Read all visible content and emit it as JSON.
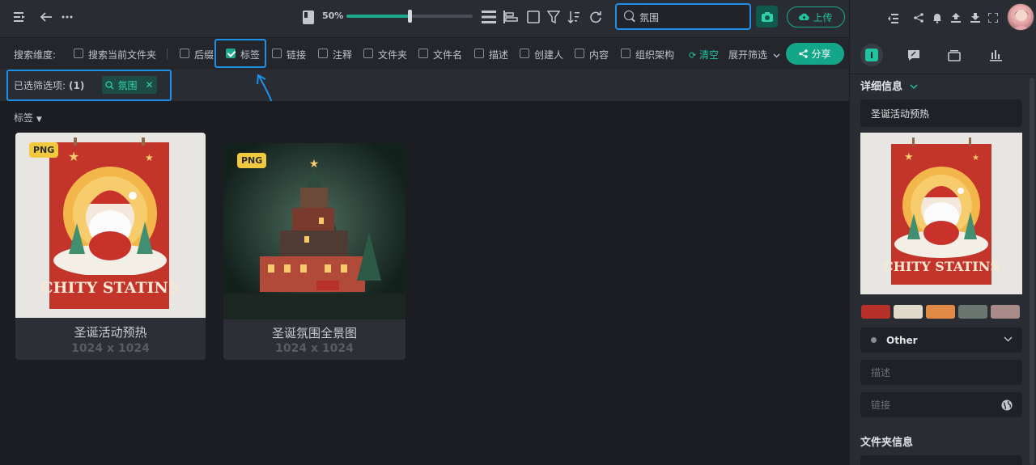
{
  "toolbar": {
    "zoom_label": "50%",
    "zoom_value": 0.5,
    "search_value": "氛围",
    "upload_label": "上传"
  },
  "filters": {
    "dimension_label": "搜索维度:",
    "current_folder": "搜索当前文件夹",
    "options": [
      "后缀",
      "标签",
      "链接",
      "注释",
      "文件夹",
      "文件名",
      "描述",
      "创建人",
      "内容",
      "组织架构"
    ],
    "checked": "标签",
    "clear_label": "清空",
    "expand_label": "展开筛选",
    "share_label": "分享"
  },
  "selected": {
    "label": "已选筛选项:",
    "count": "(1)",
    "chip_label": "氛围"
  },
  "gallery": {
    "group_label": "标签",
    "items": [
      {
        "badge": "PNG",
        "name": "圣诞活动预热",
        "dims": "1024 x 1024"
      },
      {
        "badge": "PNG",
        "name": "圣诞氛围全景图",
        "dims": "1024 x 1024"
      }
    ]
  },
  "details": {
    "section_title": "详细信息",
    "title_value": "圣诞活动预热",
    "colors": [
      "#b8302a",
      "#e2d9cd",
      "#e08a45",
      "#6b7671",
      "#a88b88"
    ],
    "category_value": "Other",
    "description_placeholder": "描述",
    "link_placeholder": "链接",
    "folder_section_title": "文件夹信息"
  },
  "poster_text": "CHITY STATINS"
}
